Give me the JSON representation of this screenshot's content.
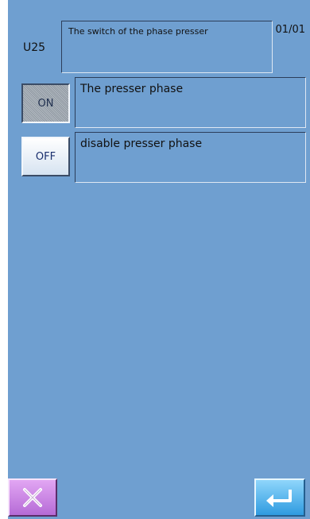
{
  "header": {
    "code": "U25",
    "title": "The switch of the phase presser",
    "page": "01/01"
  },
  "options": [
    {
      "label": "ON",
      "description": "The presser phase",
      "selected": true
    },
    {
      "label": "OFF",
      "description": "disable presser phase",
      "selected": false
    }
  ],
  "footer": {
    "cancel_icon": "close-icon",
    "enter_icon": "enter-return-icon"
  },
  "colors": {
    "background": "#6f9fd0",
    "cancel_button": "#c77fe3",
    "enter_button": "#4fb3ee"
  }
}
